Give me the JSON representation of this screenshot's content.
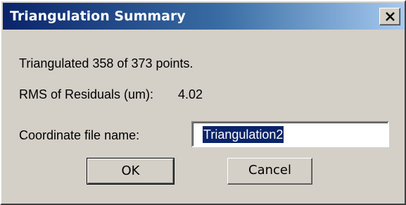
{
  "window": {
    "title": "Triangulation Summary",
    "close_icon": "close-icon"
  },
  "summary": {
    "triangulated_text": "Triangulated 358 of 373 points.",
    "rms_label": "RMS of Residuals (um):",
    "rms_value": "4.02"
  },
  "coordinate_file": {
    "label": "Coordinate file name:",
    "value": "Triangulation2"
  },
  "buttons": {
    "ok_label": "OK",
    "cancel_label": "Cancel"
  },
  "colors": {
    "titlebar_start": "#0a246a",
    "titlebar_end": "#a6caf0",
    "dialog_face": "#d4d0c8",
    "selection": "#0a246a"
  }
}
